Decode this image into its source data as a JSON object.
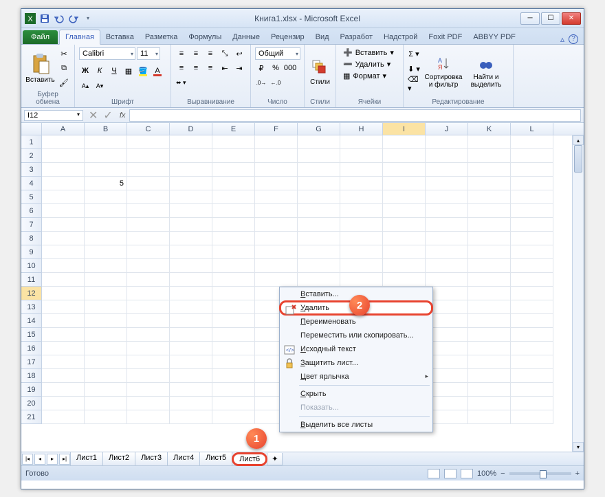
{
  "title": "Книга1.xlsx - Microsoft Excel",
  "tabs": {
    "file": "Файл",
    "home": "Главная",
    "insert": "Вставка",
    "layout": "Разметка",
    "formulas": "Формулы",
    "data": "Данные",
    "review": "Рецензир",
    "view": "Вид",
    "developer": "Разработ",
    "addins": "Надстрой",
    "foxit": "Foxit PDF",
    "abbyy": "ABBYY PDF"
  },
  "groups": {
    "clipboard": "Буфер обмена",
    "font": "Шрифт",
    "alignment": "Выравнивание",
    "number": "Число",
    "styles": "Стили",
    "cells": "Ячейки",
    "editing": "Редактирование"
  },
  "clipboard": {
    "paste": "Вставить"
  },
  "font": {
    "name": "Calibri",
    "size": "11"
  },
  "number": {
    "format": "Общий"
  },
  "styles": {
    "label": "Стили"
  },
  "cells": {
    "insert": "Вставить",
    "delete": "Удалить",
    "format": "Формат"
  },
  "editing": {
    "sort": "Сортировка и фильтр",
    "find": "Найти и выделить"
  },
  "namebox": "I12",
  "columns": [
    "A",
    "B",
    "C",
    "D",
    "E",
    "F",
    "G",
    "H",
    "I",
    "J",
    "K",
    "L"
  ],
  "rows": [
    "1",
    "2",
    "3",
    "4",
    "5",
    "6",
    "7",
    "8",
    "9",
    "10",
    "11",
    "12",
    "13",
    "14",
    "15",
    "16",
    "17",
    "18",
    "19",
    "20",
    "21"
  ],
  "cellB4": "5",
  "sheets": [
    "Лист1",
    "Лист2",
    "Лист3",
    "Лист4",
    "Лист5",
    "Лист6"
  ],
  "activeSheet": "Лист6",
  "status": "Готово",
  "zoom": "100%",
  "contextMenu": {
    "insert": "Вставить...",
    "delete": "Удалить",
    "rename": "Переименовать",
    "move": "Переместить или скопировать...",
    "source": "Исходный текст",
    "protect": "Защитить лист...",
    "tabcolor": "Цвет ярлычка",
    "hide": "Скрыть",
    "show": "Показать...",
    "selectall": "Выделить все листы"
  },
  "hotkeys": {
    "delete": "У",
    "insert": "В",
    "rename": "П",
    "move": "П",
    "source": "И",
    "protect": "З",
    "tabcolor": "Ц",
    "hide": "С",
    "show": "П",
    "selectall": "В"
  }
}
